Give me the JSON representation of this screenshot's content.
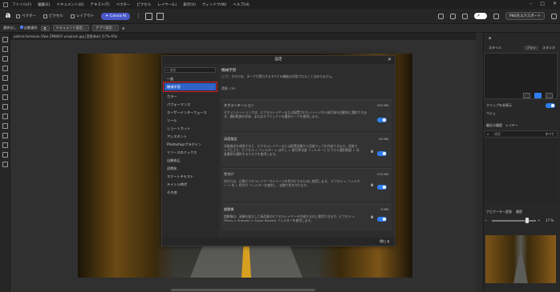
{
  "menubar": {
    "items": [
      "ファイル(F)",
      "編集(E)",
      "ドキュメント(D)",
      "テキスト(T)",
      "ベクター",
      "ピクセル",
      "レイヤー(L)",
      "表示(V)",
      "ウィンドウ(W)",
      "ヘルプ(H)"
    ]
  },
  "toolbar": {
    "logo": "a",
    "vector": "ベクター",
    "pixel": "ピクセル",
    "layout": "レイアウト",
    "canvas_ai": "Canva AI",
    "export": "PNGをエクスポート"
  },
  "options": {
    "select_label": "選択なし",
    "auto_select": "自動選択",
    "doc_settings": "ドキュメント設定...",
    "app_settings": "アプリ設定..."
  },
  "document": {
    "tab": "patrick-tomasso-1fwn-ZMWi07-unsplash.jpg [変更済み] (17%-6%)"
  },
  "dialog": {
    "title": "設定",
    "search_placeholder": "検索",
    "nav": [
      "一般",
      "機械学習",
      "カラー",
      "パフォーマンス",
      "ユーザーインターフェース",
      "ツール",
      "ショートカット",
      "アシスタント",
      "Photoshopプラグイン",
      "リソースのミックス",
      "自動修正",
      "初期化",
      "スマートテキスト",
      "テイトル時代",
      "その他"
    ],
    "active_index": 1,
    "section_title": "機械学習",
    "intro": "Iこで、そのため、ダーゲが実行するすべての機能は利用されることはありません。",
    "device_label": "環境: CPU",
    "cards": [
      {
        "title": "セグメンテーション",
        "size": "290 MB",
        "text": "セグメンテーションでは、ピクセルレイヤーまたは配置されたイメージから被写体を自動的に選択できます。選択範囲の作成、またはオブジェクトの選択モードを使用します。",
        "premium": false
      },
      {
        "title": "深度推定",
        "size": "99 MB",
        "text": "深度推定を使用すると、ピクセルレイヤーまたは配置画像から深度マップを作成できます。深度マップにより、ピクセル > フィルター > ぼかし > 被写界深度 フィルターと ピクセル選択範囲 > 深度選択を選択するマスクを使用します。",
        "premium": true
      },
      {
        "title": "色付け",
        "size": "215 MB",
        "text": "色付けは、白黒ピクセルレイヤーやイメージを色付けするために使用します。 ピクセル > フィルター > 色 > 色付け フィルターを使用し、自動で色を付けます。",
        "premium": true
      },
      {
        "title": "超解像",
        "size": "5 MB",
        "text": "超解像は、画像を拡大して高品質のピクセルレイヤーを作成するのに使用できます。ピクセル > Filters > Sharpen > Super Resolve フィルターを使用します。",
        "premium": true
      }
    ],
    "close": "閉じる"
  },
  "right_panel": {
    "tabs_top": [
      "ブラシ",
      "スタジオ"
    ],
    "style_label": "スタイル",
    "bezier": "ベジェ",
    "clip_label": "クリップを非表示",
    "layers_tab": "レイヤー",
    "layers_header": "最近の履歴",
    "search_placeholder": "検索",
    "fill_option": "すべて",
    "nav_tabs": [
      "ナビゲーター",
      "変換",
      "履歴"
    ],
    "zoom": "17 %"
  },
  "colors": {
    "accent": "#2f7ff3",
    "active_nav": "#2f63c8",
    "highlight_outline": "#e02020",
    "canva_ai": "#4b59c9"
  }
}
